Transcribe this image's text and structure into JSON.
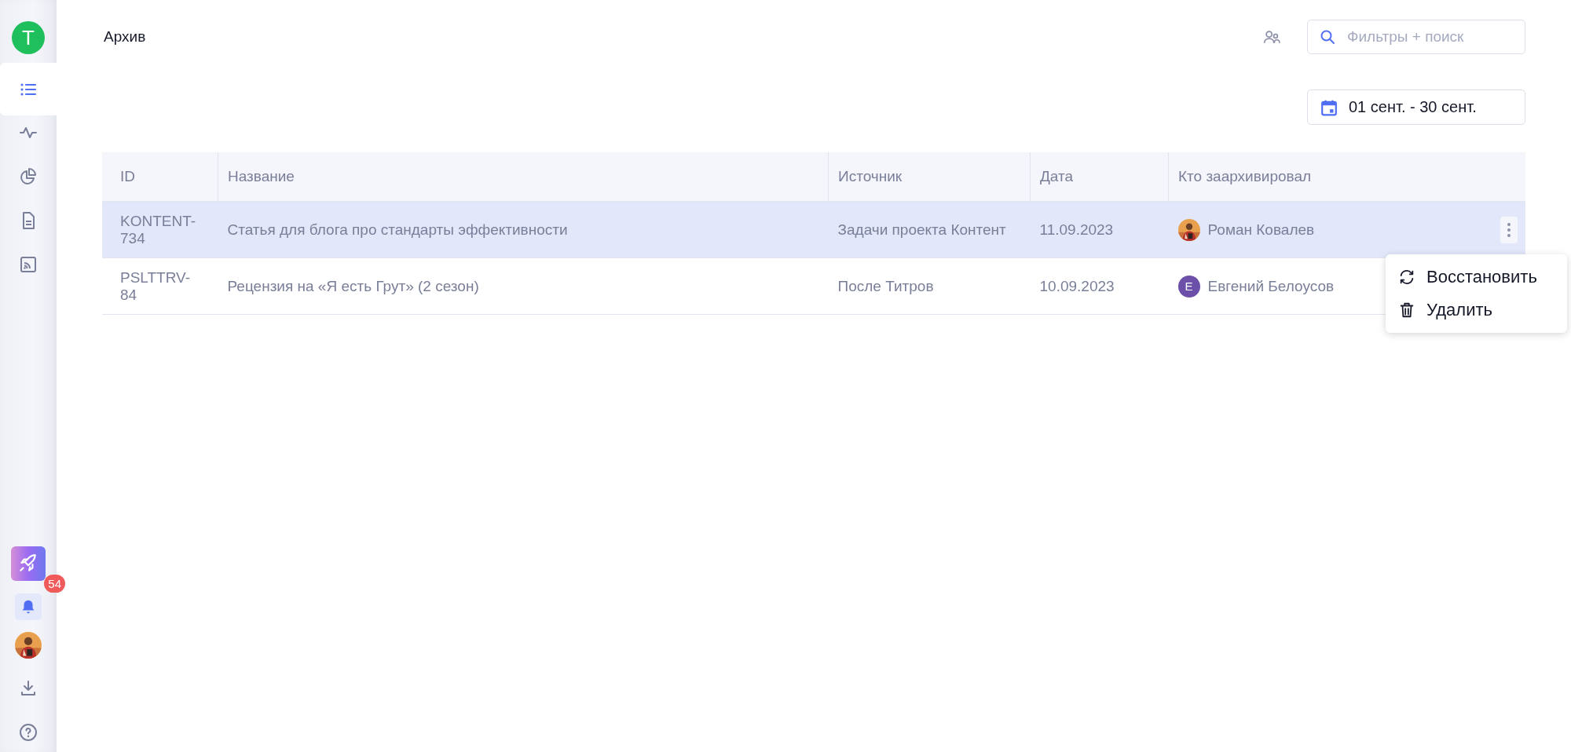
{
  "sidebar": {
    "user_initial": "T",
    "nav": [
      {
        "kind": "list",
        "selected": true
      },
      {
        "kind": "activity",
        "selected": false
      },
      {
        "kind": "pie",
        "selected": false
      },
      {
        "kind": "document",
        "selected": false
      },
      {
        "kind": "feed",
        "selected": false
      }
    ],
    "notifications_badge": "54"
  },
  "header": {
    "title": "Архив",
    "search": {
      "placeholder": "Фильтры + поиск"
    },
    "date_range": "01 сент. - 30 сент."
  },
  "table": {
    "columns": [
      "ID",
      "Название",
      "Источник",
      "Дата",
      "Кто заархивировал"
    ],
    "rows": [
      {
        "id": "KONTENT-734",
        "name": "Статья для блога про стандарты эффективности",
        "source": "Задачи проекта Контент",
        "date": "11.09.2023",
        "archived_by": {
          "name": "Роман Ковалев"
        },
        "selected": true
      },
      {
        "id": "PSLTTRV-84",
        "name": "Рецензия на «Я есть Грут» (2 сезон)",
        "source": "После Титров",
        "date": "10.09.2023",
        "archived_by": {
          "name": "Евгений Белоусов",
          "avatar": {
            "kind": "letter",
            "letter": "E",
            "color": "#6b4fa8"
          }
        },
        "selected": false
      }
    ]
  },
  "context_menu": {
    "items": [
      {
        "kind": "restore",
        "label": "Восстановить"
      },
      {
        "kind": "delete",
        "label": "Удалить"
      }
    ]
  }
}
